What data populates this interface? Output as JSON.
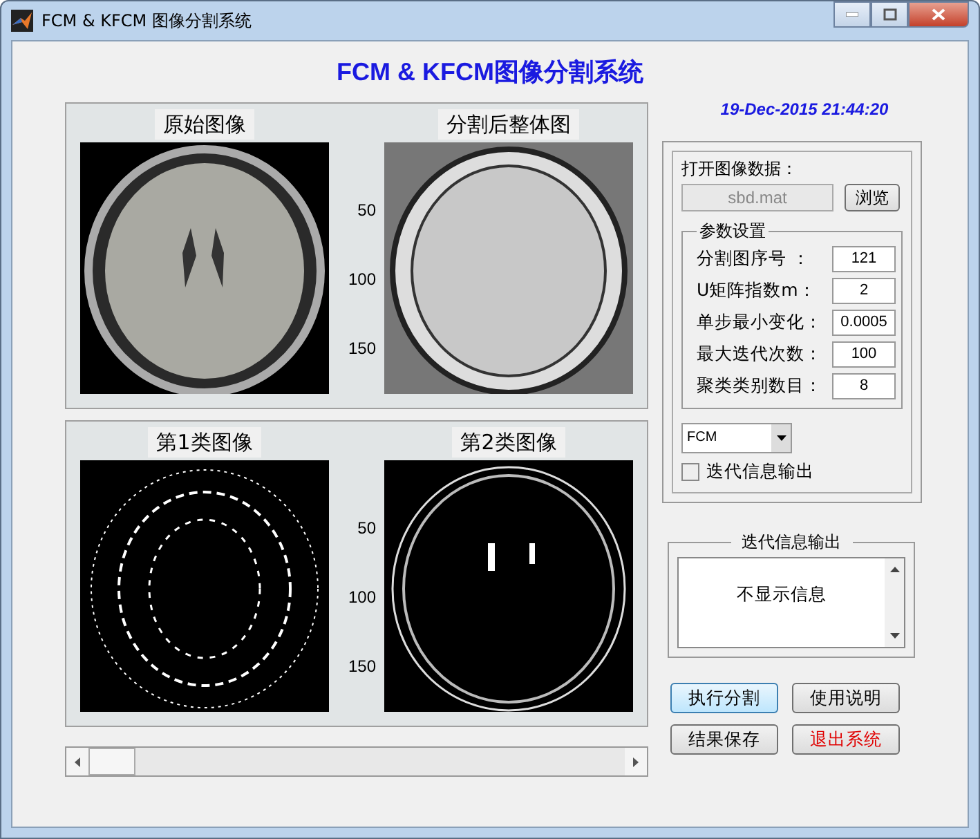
{
  "window": {
    "title": "FCM & KFCM 图像分割系统"
  },
  "heading": "FCM & KFCM图像分割系统",
  "datetime": "19-Dec-2015 21:44:20",
  "panels": [
    {
      "plots": [
        {
          "title": "原始图像",
          "kind": "grayscale"
        },
        {
          "title": "分割后整体图",
          "kind": "segmented",
          "yticks": [
            "50",
            "100",
            "150"
          ]
        }
      ]
    },
    {
      "plots": [
        {
          "title": "第1类图像",
          "kind": "edges"
        },
        {
          "title": "第2类图像",
          "kind": "skull",
          "yticks": [
            "50",
            "100",
            "150"
          ]
        }
      ]
    }
  ],
  "open_data": {
    "label": "打开图像数据：",
    "value": "sbd.mat",
    "disabled": true,
    "browse": "浏览"
  },
  "params": {
    "title": "参数设置",
    "fields": [
      {
        "label": "分割图序号 ：",
        "value": "121"
      },
      {
        "label": "U矩阵指数m：",
        "value": "2"
      },
      {
        "label": "单步最小变化：",
        "value": "0.0005"
      },
      {
        "label": "最大迭代次数：",
        "value": "100"
      },
      {
        "label": "聚类类别数目：",
        "value": "8"
      }
    ]
  },
  "method": {
    "value": "FCM"
  },
  "iter_checkbox": {
    "label": "迭代信息输出",
    "checked": false
  },
  "info": {
    "title": "迭代信息输出",
    "text": "不显示信息"
  },
  "buttons": [
    {
      "label": "执行分割",
      "kind": "focused"
    },
    {
      "label": "使用说明",
      "kind": "normal"
    },
    {
      "label": "结果保存",
      "kind": "normal"
    },
    {
      "label": "退出系统",
      "kind": "danger"
    }
  ]
}
